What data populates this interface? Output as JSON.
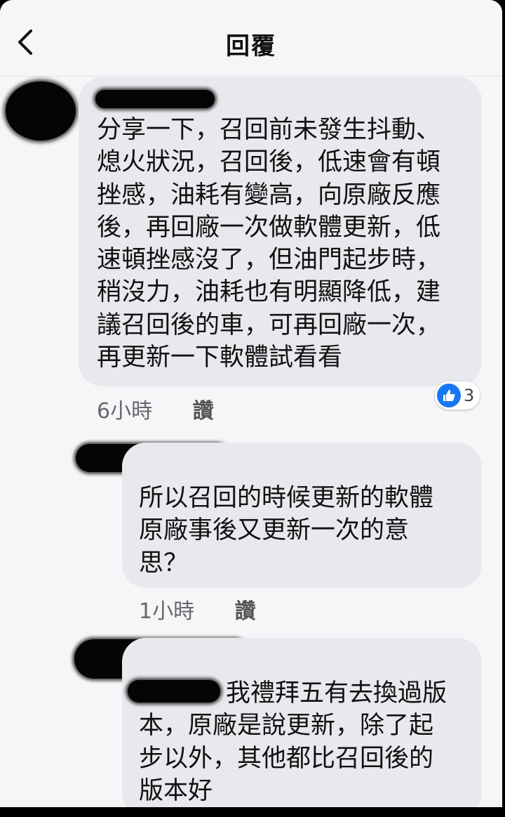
{
  "header": {
    "title": "回覆"
  },
  "comments": [
    {
      "text": "分享一下，召回前未發生抖動、\n熄火狀況，召回後，低速會有頓\n挫感，油耗有變高，向原廠反應\n後，再回廠一次做軟體更新，低\n速頓挫感沒了，但油門起步時，\n稍沒力，油耗也有明顯降低，建\n議召回後的車，可再回廠一次，\n再更新一下軟體試看看",
      "time": "6小時",
      "like_label": "讚",
      "reaction_count": "3"
    },
    {
      "text": "所以召回的時候更新的軟體\n原廠事後又更新一次的意\n思？",
      "time": "1小時",
      "like_label": "讚"
    },
    {
      "text": "我禮拜五有去換過版\n本，原廠是說更新，除了起\n步以外，其他都比召回後的\n版本好"
    }
  ],
  "icons": {
    "back": "chevron-left-icon",
    "reaction": "thumbs-up-icon"
  },
  "colors": {
    "bubble": "#e8e9ed",
    "like_blue": "#1877f2"
  }
}
